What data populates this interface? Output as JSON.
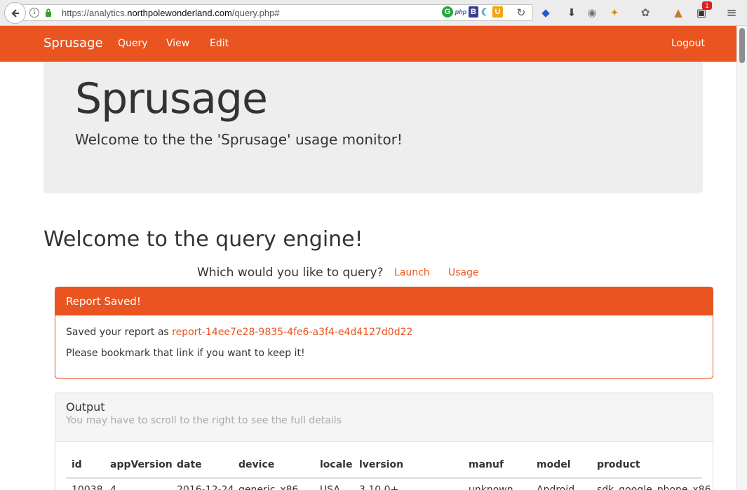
{
  "browser": {
    "url_prefix": "https://analytics.",
    "url_domain": "northpolewonderland.com",
    "url_suffix": "/query.php#",
    "notification_count": "1"
  },
  "navbar": {
    "brand": "Sprusage",
    "links": [
      "Query",
      "View",
      "Edit"
    ],
    "logout": "Logout"
  },
  "jumbotron": {
    "title": "Sprusage",
    "subtitle": "Welcome to the the 'Sprusage' usage monitor!"
  },
  "query": {
    "heading": "Welcome to the query engine!",
    "prompt": "Which would you like to query?",
    "options": [
      "Launch",
      "Usage"
    ]
  },
  "report": {
    "heading": "Report Saved!",
    "saved_prefix": "Saved your report as ",
    "report_id": "report-14ee7e28-9835-4fe6-a3f4-e4d4127d0d22",
    "bookmark_note": "Please bookmark that link if you want to keep it!"
  },
  "output": {
    "title": "Output",
    "hint": "You may have to scroll to the right to see the full details",
    "columns": [
      "id",
      "appVersion",
      "date",
      "device",
      "locale",
      "lversion",
      "manuf",
      "model",
      "product"
    ],
    "rows": [
      [
        "10038",
        "4",
        "2016-12-24",
        "generic_x86",
        "USA",
        "3.10.0+",
        "unknown",
        "Android",
        "sdk_google_phone_x86"
      ]
    ]
  },
  "colors": {
    "brand_orange": "#e95420",
    "jumbotron_bg": "#eeeeee"
  }
}
